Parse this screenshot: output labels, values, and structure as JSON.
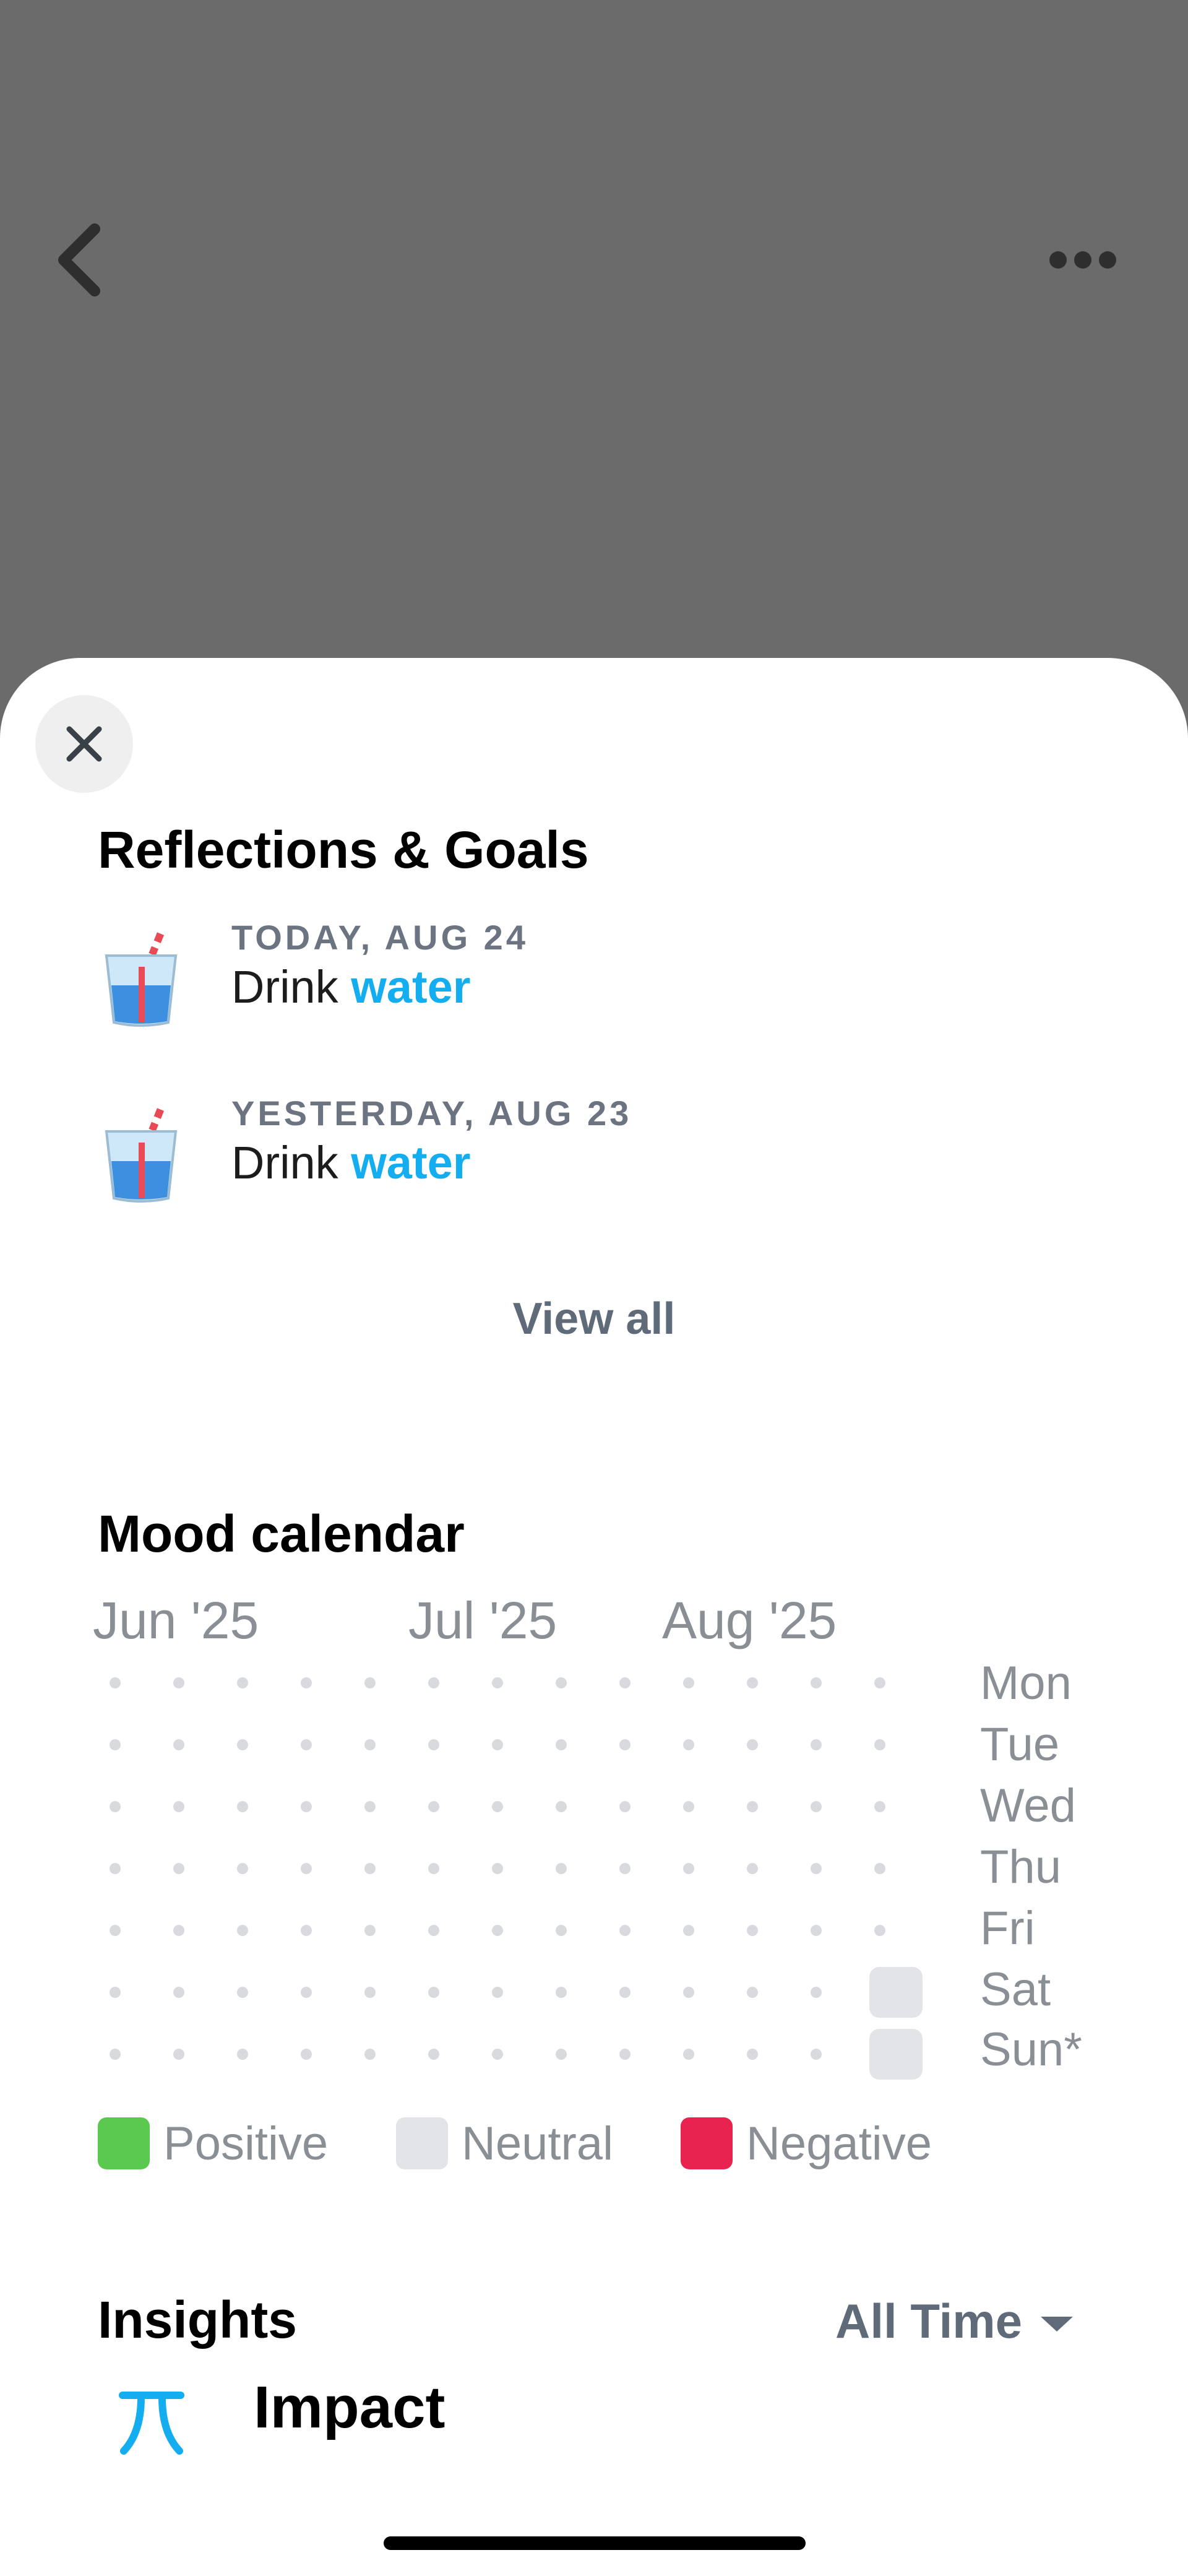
{
  "header": {
    "back_icon": "chevron-left-icon",
    "more_icon": "ellipsis-icon"
  },
  "sheet": {
    "close_icon": "close-icon",
    "reflections": {
      "title": "Reflections & Goals",
      "items": [
        {
          "date": "TODAY, AUG 24",
          "text_prefix": "Drink",
          "text_highlight": "water",
          "icon": "cup-with-straw-icon"
        },
        {
          "date": "YESTERDAY, AUG 23",
          "text_prefix": "Drink",
          "text_highlight": "water",
          "icon": "cup-with-straw-icon"
        }
      ],
      "view_all_label": "View all"
    },
    "mood_calendar": {
      "title": "Mood calendar",
      "months": [
        "Jun '25",
        "Jul '25",
        "Aug '25"
      ],
      "days": [
        "Mon",
        "Tue",
        "Wed",
        "Thu",
        "Fri",
        "Sat",
        "Sun*"
      ],
      "weeks": 13,
      "neutral_days": [
        {
          "week": 13,
          "day": "Sat"
        },
        {
          "week": 13,
          "day": "Sun*"
        }
      ],
      "legend": [
        {
          "label": "Positive",
          "color": "#5ac94e"
        },
        {
          "label": "Neutral",
          "color": "#e3e4e8"
        },
        {
          "label": "Negative",
          "color": "#e8234f"
        }
      ]
    },
    "insights": {
      "title": "Insights",
      "filter_label": "All Time",
      "filter_icon": "caret-down-icon",
      "impact_title": "Impact",
      "impact_icon": "impact-icon",
      "accent": "#14aef0"
    }
  }
}
